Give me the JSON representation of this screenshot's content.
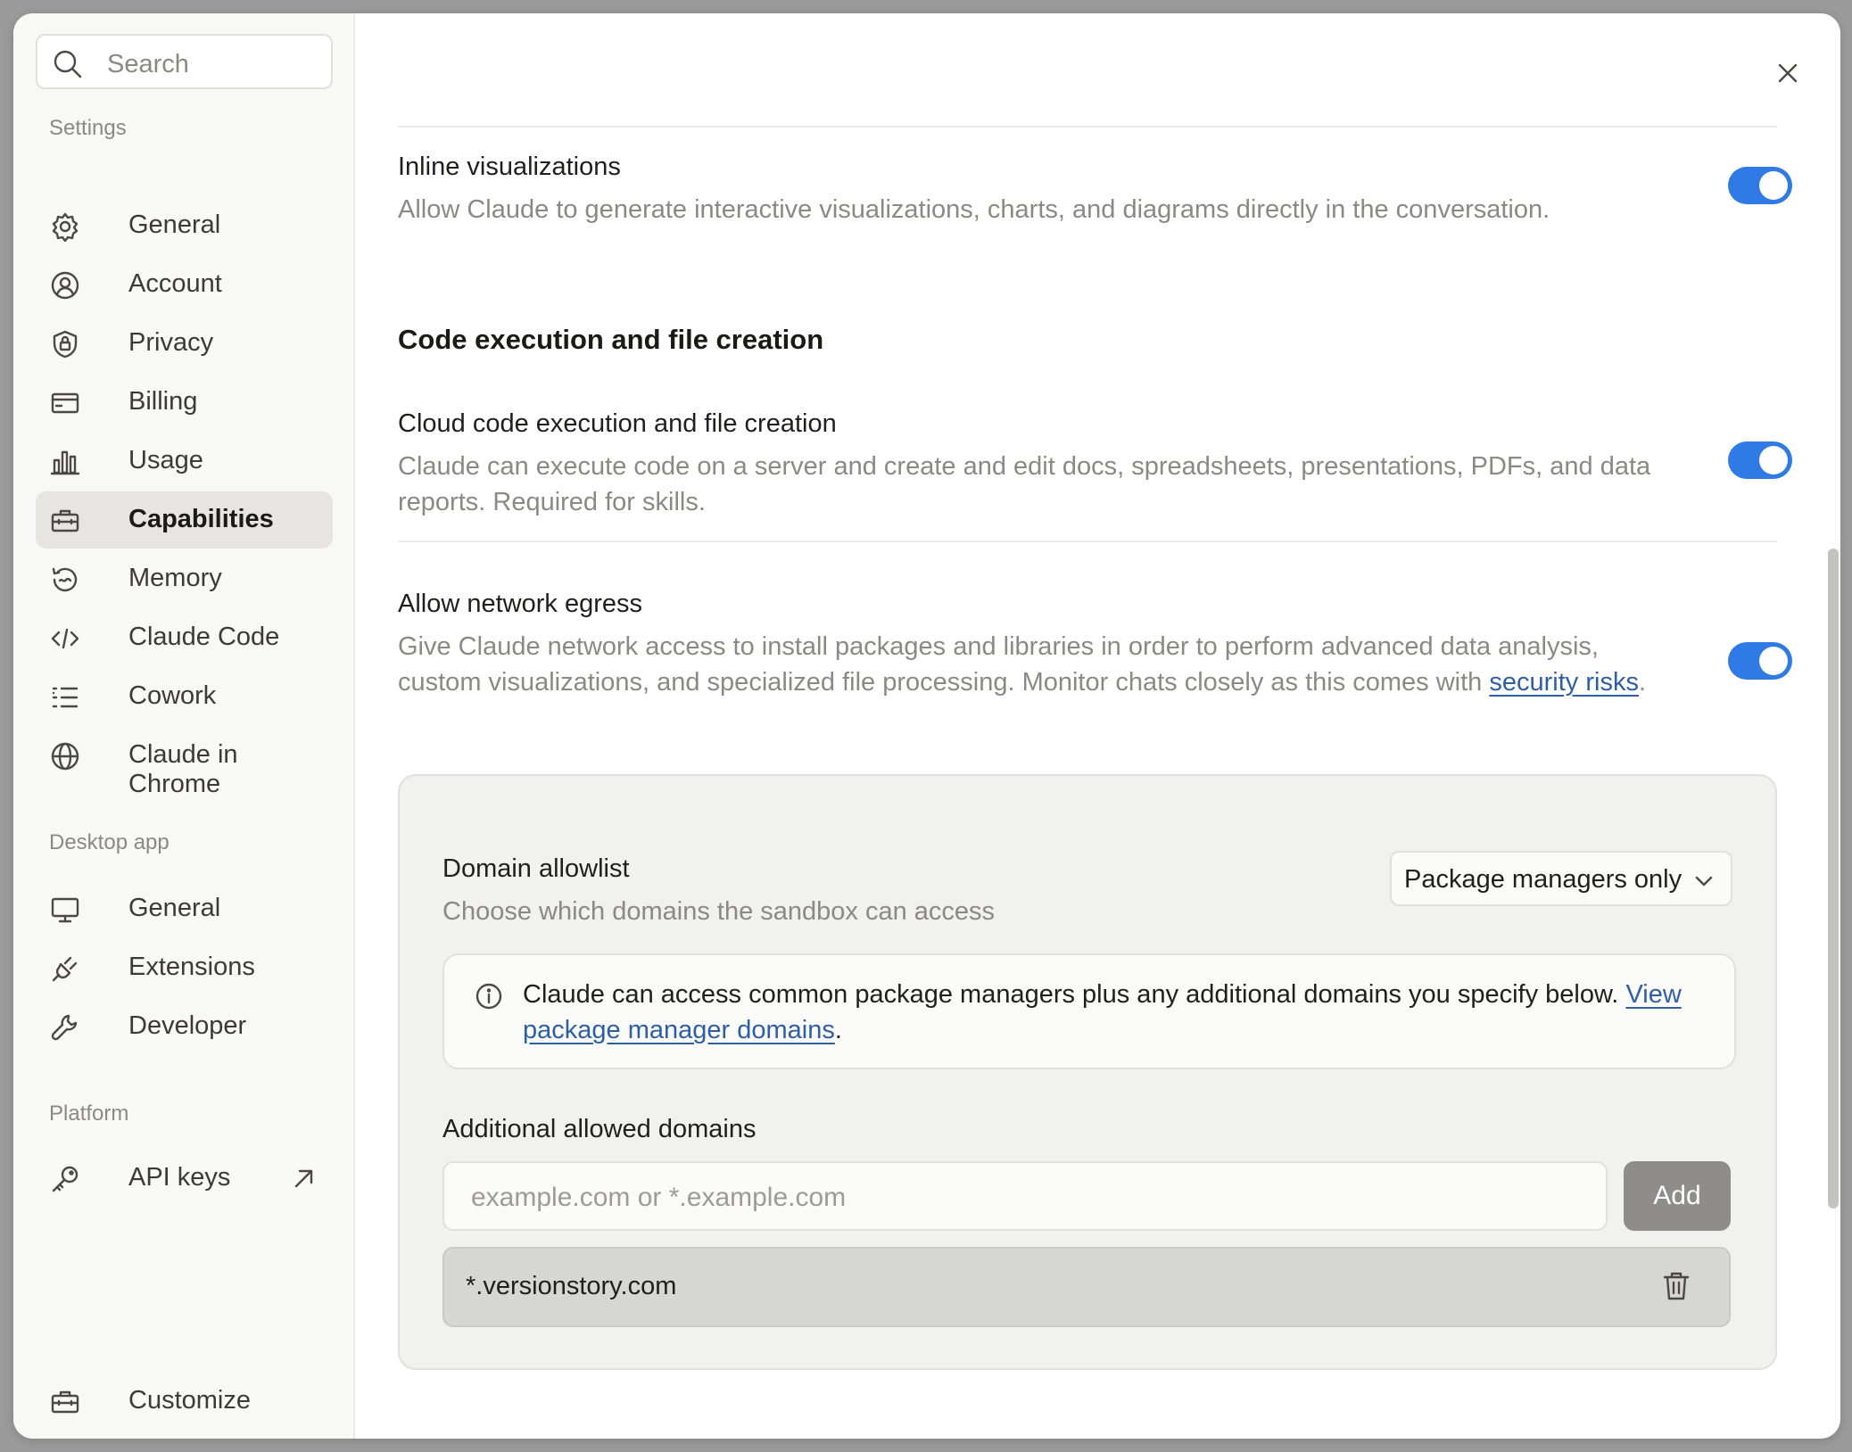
{
  "sidebar": {
    "search_placeholder": "Search",
    "settings_label": "Settings",
    "settings_items": [
      {
        "label": "General",
        "icon": "gear-icon"
      },
      {
        "label": "Account",
        "icon": "user-circle-icon"
      },
      {
        "label": "Privacy",
        "icon": "shield-lock-icon"
      },
      {
        "label": "Billing",
        "icon": "credit-card-icon"
      },
      {
        "label": "Usage",
        "icon": "bar-chart-icon"
      },
      {
        "label": "Capabilities",
        "icon": "briefcase-icon",
        "active": true
      },
      {
        "label": "Memory",
        "icon": "history-icon"
      },
      {
        "label": "Claude Code",
        "icon": "code-icon"
      },
      {
        "label": "Cowork",
        "icon": "checklist-icon"
      },
      {
        "label": "Claude in Chrome",
        "icon": "globe-icon"
      }
    ],
    "desktop_label": "Desktop app",
    "desktop_items": [
      {
        "label": "General",
        "icon": "monitor-icon"
      },
      {
        "label": "Extensions",
        "icon": "plug-icon"
      },
      {
        "label": "Developer",
        "icon": "wrench-icon"
      }
    ],
    "platform_label": "Platform",
    "platform_items": [
      {
        "label": "API keys",
        "icon": "key-icon",
        "external": true
      }
    ],
    "customize_label": "Customize"
  },
  "main": {
    "inline_viz": {
      "title": "Inline visualizations",
      "desc": "Allow Claude to generate interactive visualizations, charts, and diagrams directly in the conversation.",
      "enabled": true
    },
    "code_section_heading": "Code execution and file creation",
    "cloud_code": {
      "title": "Cloud code execution and file creation",
      "desc": "Claude can execute code on a server and create and edit docs, spreadsheets, presentations, PDFs, and data reports. Required for skills.",
      "enabled": true
    },
    "network_egress": {
      "title": "Allow network egress",
      "desc_prefix": "Give Claude network access to install packages and libraries in order to perform advanced data analysis, custom visualizations, and specialized file processing. Monitor chats closely as this comes with ",
      "link": "security risks",
      "desc_suffix": ".",
      "enabled": true
    },
    "allowlist": {
      "title": "Domain allowlist",
      "desc": "Choose which domains the sandbox can access",
      "dropdown_value": "Package managers only",
      "info_prefix": "Claude can access common package managers plus any additional domains you specify below. ",
      "info_link": "View package manager domains",
      "info_suffix": ".",
      "additional_label": "Additional allowed domains",
      "input_placeholder": "example.com or *.example.com",
      "add_label": "Add",
      "domains": [
        "*.versionstory.com"
      ]
    }
  },
  "colors": {
    "toggle_on": "#2f7ae5",
    "link": "#2f5ea8",
    "active_nav_bg": "#e6e5e2"
  }
}
